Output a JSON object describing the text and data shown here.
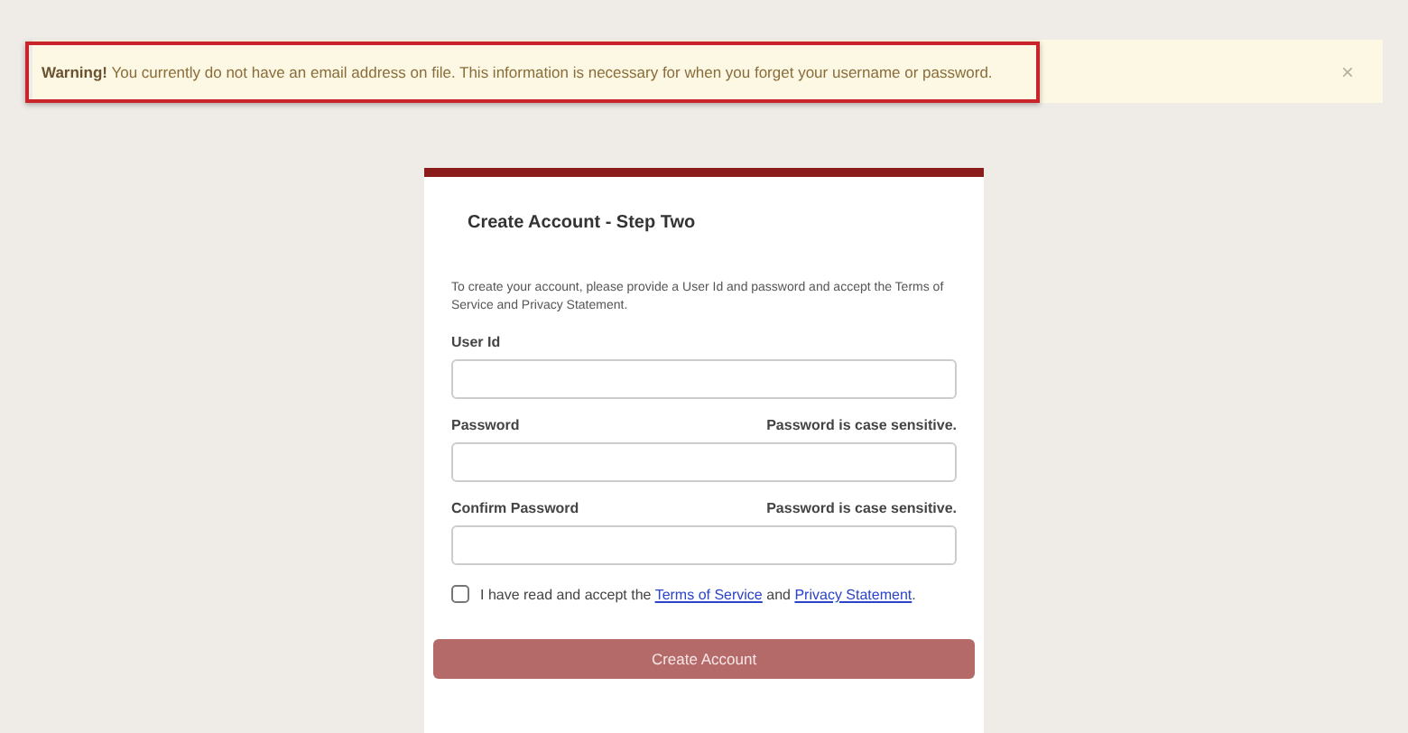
{
  "alert": {
    "message": "**Warning!** You currently do not have an email address on file. This information is necessary for when you forget your username or password.",
    "close": "×"
  },
  "form": {
    "title": "Create Account - Step Two",
    "intro": "To create your account, please provide a User Id and password and accept the Terms of Service and Privacy Statement.",
    "fields": [
      {
        "label": "User Id"
      },
      {
        "label": "Password",
        "hint": "Password is case sensitive."
      },
      {
        "label": "Confirm Password",
        "hint": "Password is case sensitive."
      }
    ],
    "agreement": {
      "checked": false,
      "parts": [
        {
          "kind": "text",
          "text": "I have read and accept the"
        },
        {
          "kind": "link",
          "text": "Terms of Service"
        },
        {
          "kind": "text",
          "text": "and"
        },
        {
          "kind": "link",
          "text": "Privacy Statement"
        },
        {
          "kind": "text",
          "text": "."
        }
      ]
    },
    "submit": "Create Account"
  }
}
